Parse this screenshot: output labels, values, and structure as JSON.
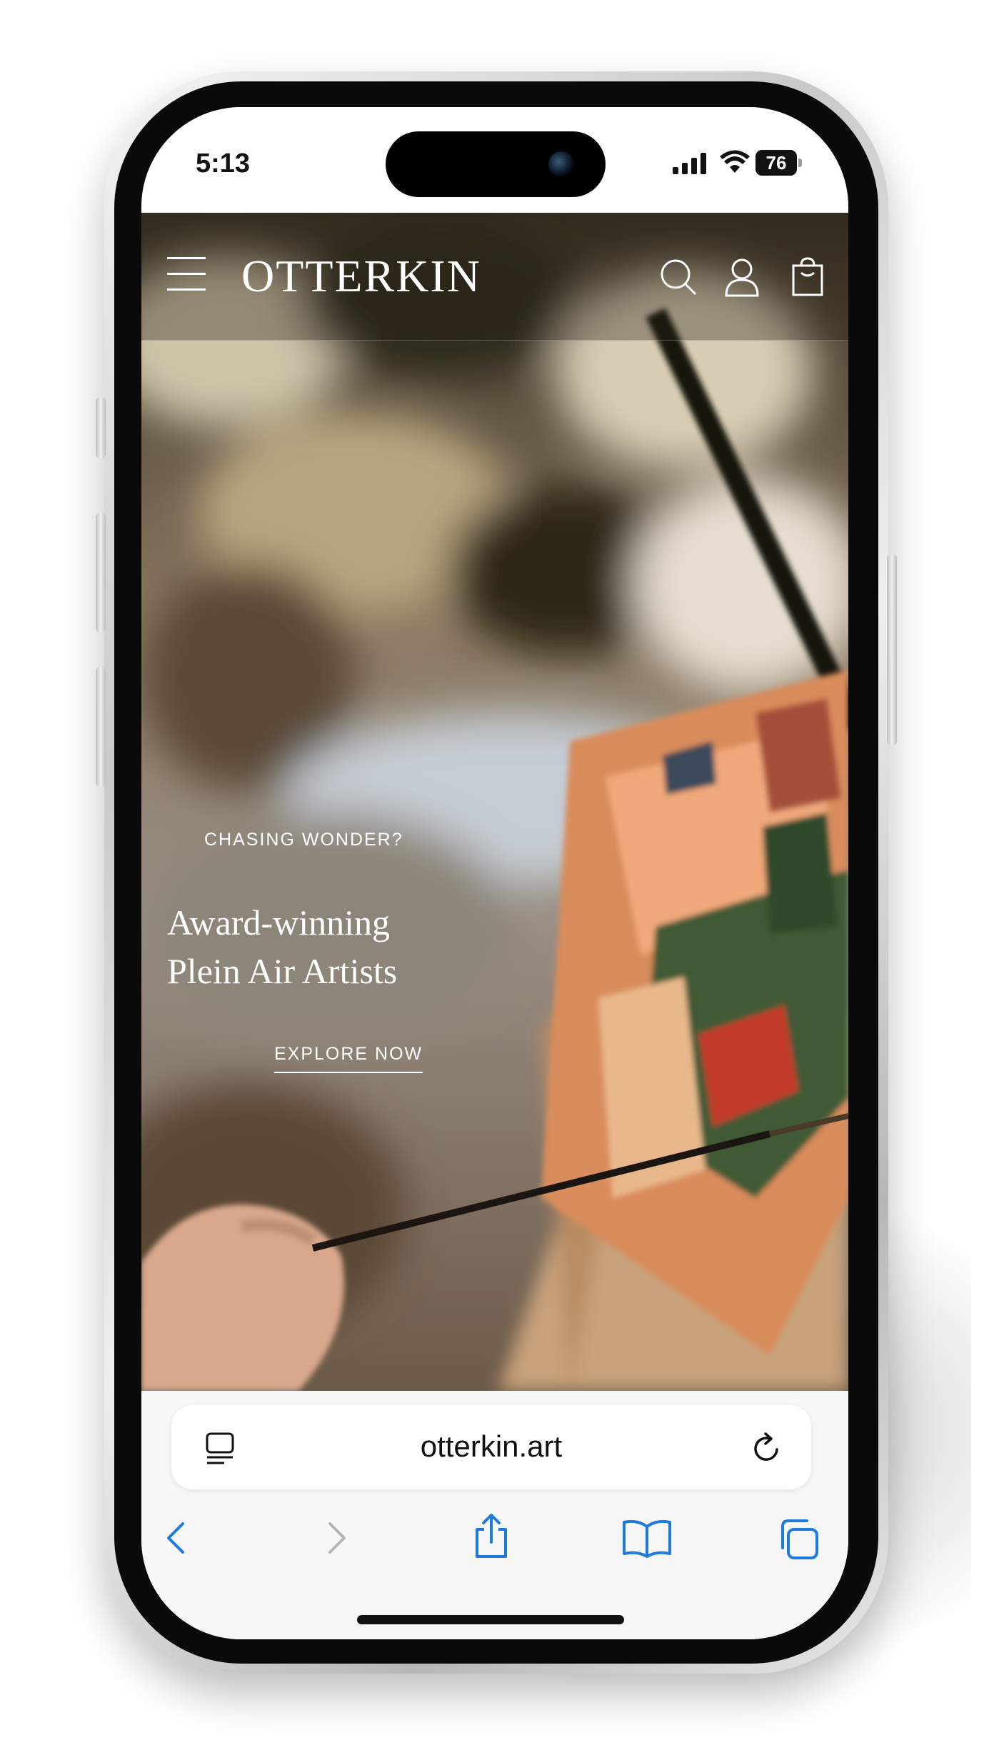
{
  "status_bar": {
    "time": "5:13",
    "battery_level": "76",
    "icons": [
      "cellular-signal-icon",
      "wifi-icon",
      "battery-icon"
    ]
  },
  "site": {
    "logo": "OTTERKIN",
    "header_icons": [
      "menu-icon",
      "search-icon",
      "account-icon",
      "shopping-bag-icon"
    ]
  },
  "hero": {
    "eyebrow": "CHASING WONDER?",
    "headline": "Award-winning Plein Air Artists",
    "cta_label": "EXPLORE NOW"
  },
  "browser": {
    "url": "otterkin.art",
    "url_bar_icons": [
      "reader-mode-icon",
      "reload-icon"
    ],
    "toolbar_icons": [
      "back-icon",
      "forward-icon",
      "share-icon",
      "bookmarks-icon",
      "tabs-icon"
    ],
    "accent_color": "#1f7ae0",
    "disabled_color": "#b5b5b5"
  }
}
